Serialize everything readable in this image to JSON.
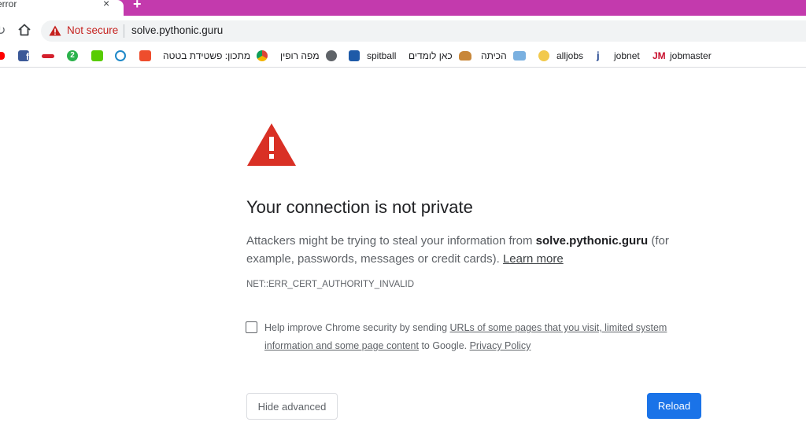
{
  "browser": {
    "tab": {
      "title": "error",
      "close": "×"
    },
    "new_tab": "+",
    "omnibox": {
      "security_label": "Not secure",
      "url": "solve.pythonic.guru"
    },
    "colors": {
      "tab_strip": "#c33aad",
      "not_secure": "#c5221f",
      "primary_button": "#1a73e8",
      "danger": "#d93025"
    }
  },
  "bookmarks": [
    {
      "icon": "youtube-icon",
      "label": ""
    },
    {
      "icon": "facebook-icon",
      "label": ""
    },
    {
      "icon": "ynet-icon",
      "label": ""
    },
    {
      "icon": "channel-2-icon",
      "label": ""
    },
    {
      "icon": "duolingo-icon",
      "label": ""
    },
    {
      "icon": "edge-icon",
      "label": ""
    },
    {
      "icon": "shopping-bag-icon",
      "label": ""
    },
    {
      "icon": "chrome-web-icon",
      "label": "מתכון: פשטידת בטטה"
    },
    {
      "icon": "globe-icon",
      "label": "מפה רופין"
    },
    {
      "icon": "spitball-icon",
      "label": "spitball"
    },
    {
      "icon": "burger-icon",
      "label": "כאן לומדים"
    },
    {
      "icon": "classroom-icon",
      "label": "הכיתה"
    },
    {
      "icon": "alljobs-icon",
      "label": "alljobs"
    },
    {
      "icon": "jobnet-icon",
      "label": "jobnet"
    },
    {
      "icon": "jobmaster-icon",
      "label": "jobmaster"
    }
  ],
  "interstitial": {
    "heading": "Your connection is not private",
    "explanation_before": "Attackers might be trying to steal your information from ",
    "domain": "solve.pythonic.guru",
    "explanation_after": " (for example, passwords, messages or credit cards). ",
    "learn_more": "Learn more",
    "error_code": "NET::ERR_CERT_AUTHORITY_INVALID",
    "optin": {
      "checked": false,
      "text_before": "Help improve Chrome security by sending ",
      "link_text": "URLs of some pages that you visit, limited system information and some page content",
      "text_middle": " to Google. ",
      "privacy_link": "Privacy Policy"
    },
    "hide_advanced": "Hide advanced",
    "reload": "Reload"
  }
}
